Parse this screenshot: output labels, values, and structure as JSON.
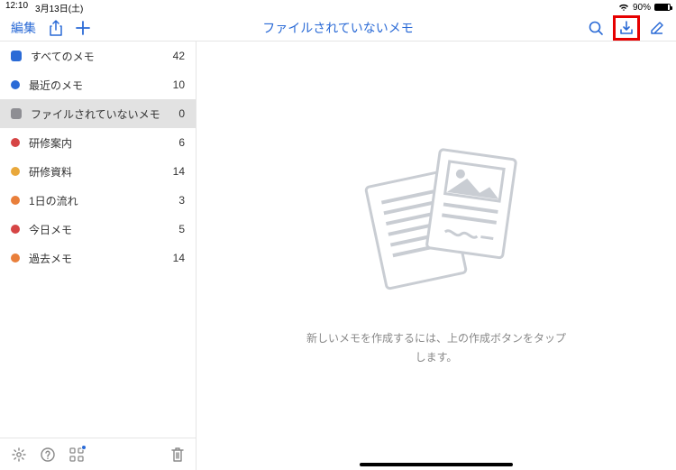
{
  "status": {
    "time": "12:10",
    "date": "3月13日(土)",
    "battery_pct": "90%"
  },
  "header": {
    "edit": "編集",
    "title": "ファイルされていないメモ"
  },
  "sidebar": {
    "items": [
      {
        "icon": "stack",
        "color": "#2a6ad6",
        "label": "すべてのメモ",
        "count": "42",
        "selected": false
      },
      {
        "icon": "circle",
        "color": "#2a6ad6",
        "label": "最近のメモ",
        "count": "10",
        "selected": false
      },
      {
        "icon": "stack",
        "color": "#8e8e93",
        "label": "ファイルされていないメモ",
        "count": "0",
        "selected": true
      },
      {
        "icon": "circle",
        "color": "#d64545",
        "label": "研修案内",
        "count": "6",
        "selected": false
      },
      {
        "icon": "circle",
        "color": "#e9a83b",
        "label": "研修資料",
        "count": "14",
        "selected": false
      },
      {
        "icon": "circle",
        "color": "#e97f3b",
        "label": "1日の流れ",
        "count": "3",
        "selected": false
      },
      {
        "icon": "circle",
        "color": "#d64545",
        "label": "今日メモ",
        "count": "5",
        "selected": false
      },
      {
        "icon": "circle",
        "color": "#e97f3b",
        "label": "過去メモ",
        "count": "14",
        "selected": false
      }
    ]
  },
  "empty": {
    "text": "新しいメモを作成するには、上の作成ボタンをタップ\nします。"
  }
}
